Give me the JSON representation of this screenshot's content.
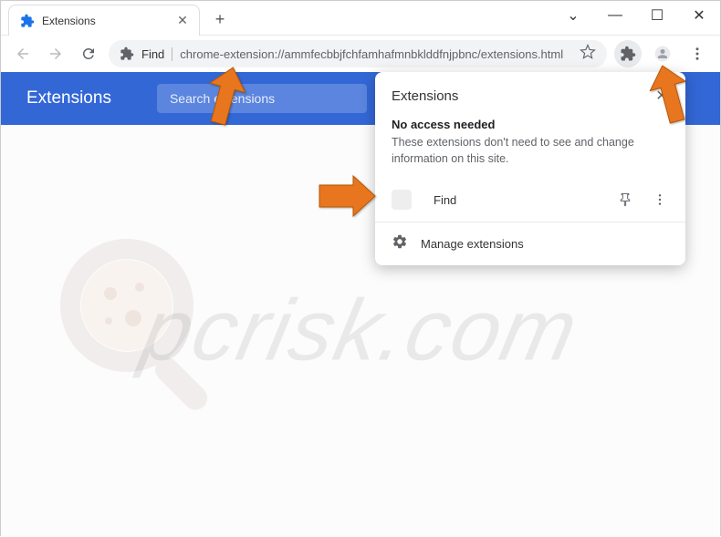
{
  "window": {
    "tab_title": "Extensions",
    "controls": {
      "dropdown": "⌄",
      "minimize": "—",
      "maximize": "☐",
      "close": "✕"
    }
  },
  "toolbar": {
    "omnibox_app": "Find",
    "url": "chrome-extension://ammfecbbjfchfamhafmnbklddfnjpbnc/extensions.html"
  },
  "page": {
    "title": "Extensions",
    "search_placeholder": "Search extensions"
  },
  "popup": {
    "title": "Extensions",
    "subtitle": "No access needed",
    "description": "These extensions don't need to see and change information on this site.",
    "extension_name": "Find",
    "manage_label": "Manage extensions"
  },
  "watermark": "pcrisk.com"
}
